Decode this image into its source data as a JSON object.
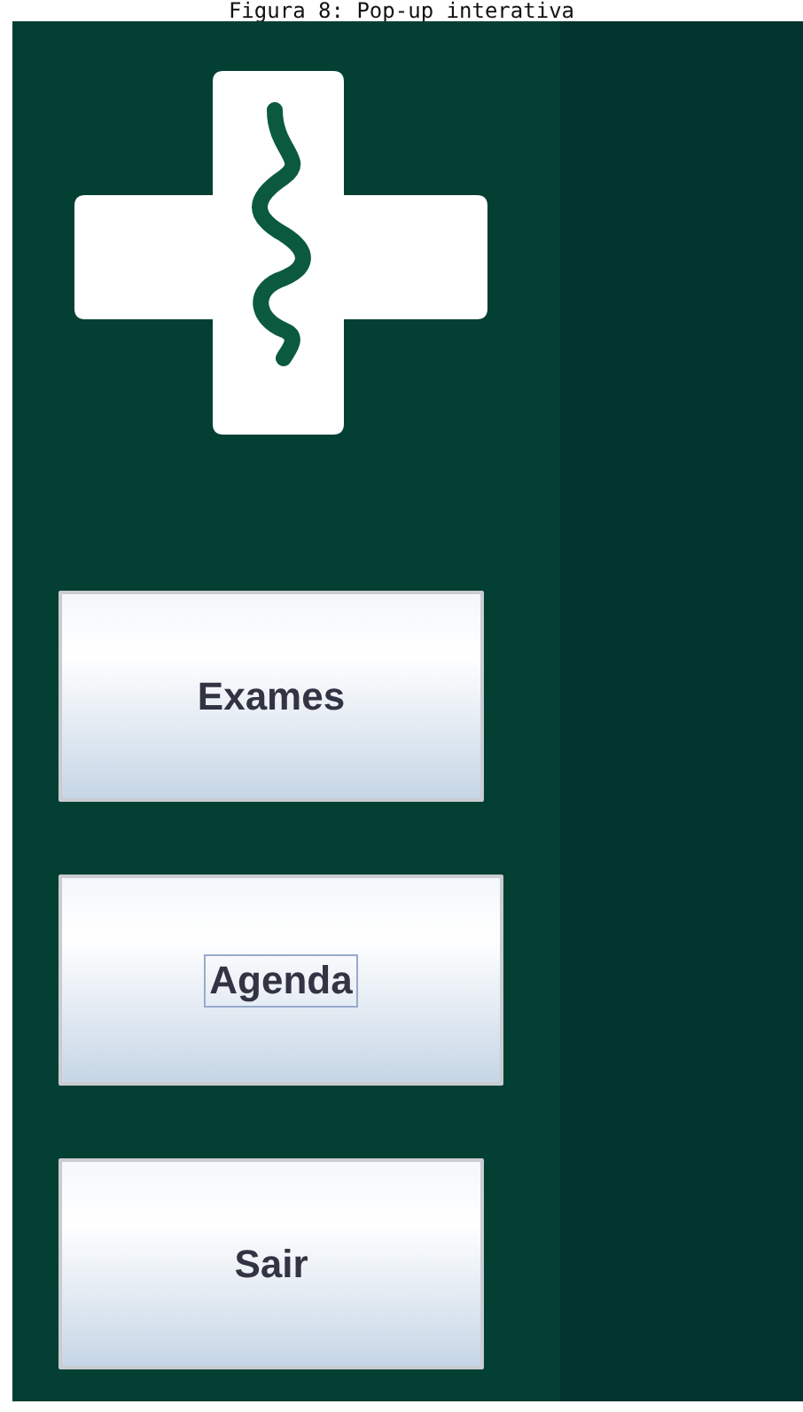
{
  "caption": "Figura 8: Pop-up interativa",
  "buttons": [
    {
      "label": "Exames",
      "focused": false
    },
    {
      "label": "Agenda",
      "focused": true
    },
    {
      "label": "Sair",
      "focused": false
    }
  ]
}
